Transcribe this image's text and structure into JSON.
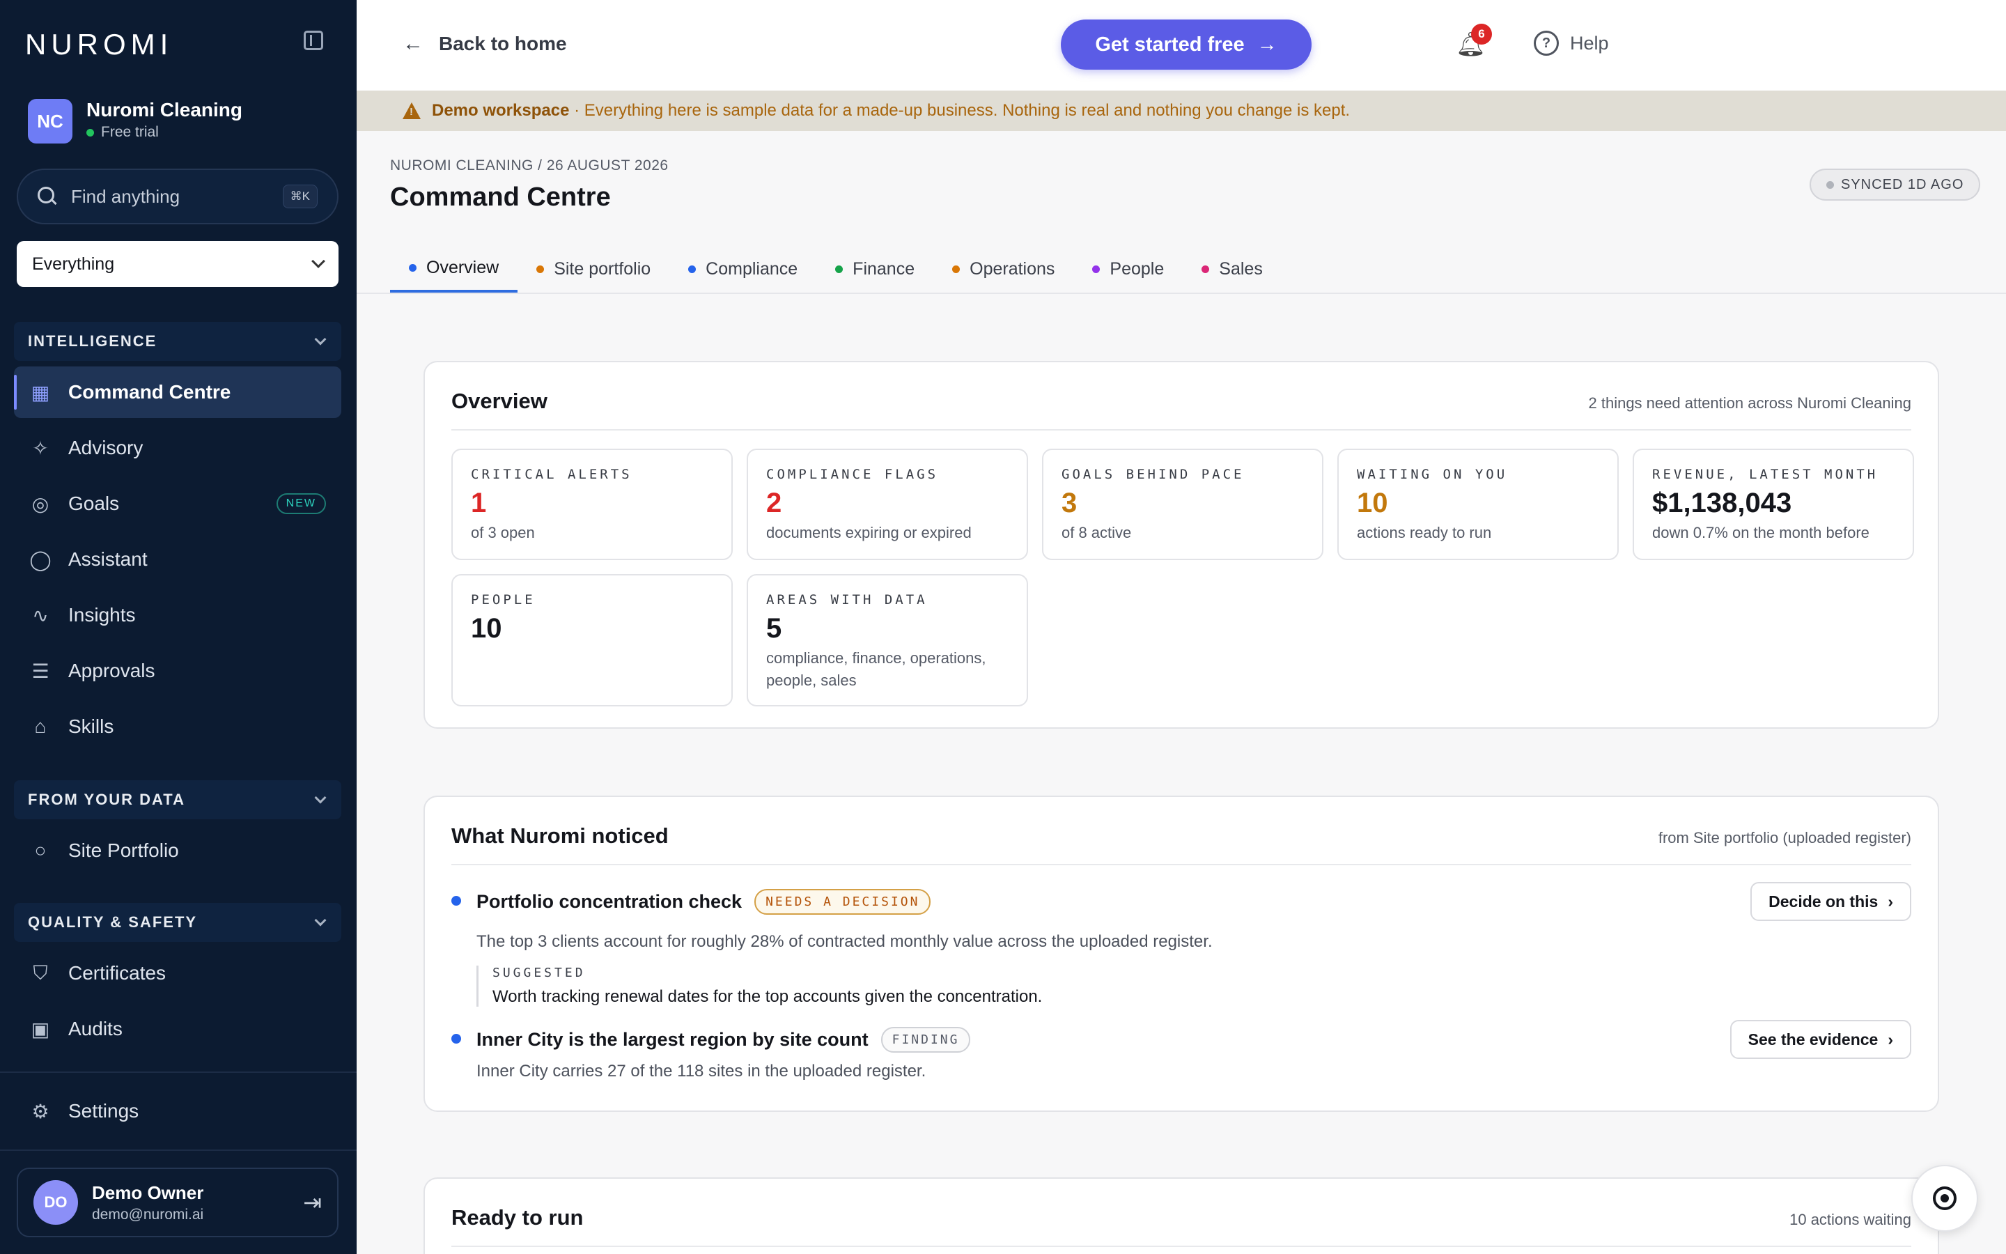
{
  "sidebar": {
    "logo": "NUROMI",
    "workspace": {
      "initials": "NC",
      "name": "Nuromi Cleaning",
      "plan": "Free trial"
    },
    "search": {
      "placeholder": "Find anything",
      "shortcut": "⌘K"
    },
    "scope": "Everything",
    "sections": [
      {
        "label": "INTELLIGENCE",
        "items": [
          {
            "label": "Command Centre",
            "icon": "grid-icon",
            "active": true
          },
          {
            "label": "Advisory",
            "icon": "sparkles-icon"
          },
          {
            "label": "Goals",
            "icon": "target-icon",
            "badge": "NEW"
          },
          {
            "label": "Assistant",
            "icon": "chat-bubble-icon"
          },
          {
            "label": "Insights",
            "icon": "pulse-icon"
          },
          {
            "label": "Approvals",
            "icon": "checklist-icon"
          },
          {
            "label": "Skills",
            "icon": "graduation-cap-icon"
          }
        ]
      },
      {
        "label": "FROM YOUR DATA",
        "items": [
          {
            "label": "Site Portfolio",
            "icon": "circle-icon"
          }
        ]
      },
      {
        "label": "QUALITY & SAFETY",
        "items": [
          {
            "label": "Certificates",
            "icon": "shield-check-icon"
          },
          {
            "label": "Audits",
            "icon": "clipboard-check-icon"
          }
        ]
      }
    ],
    "settings": "Settings",
    "user": {
      "initials": "DO",
      "name": "Demo Owner",
      "email": "demo@nuromi.ai"
    }
  },
  "topbar": {
    "back": "Back to home",
    "cta": "Get started free",
    "notifications": "6",
    "help": "Help"
  },
  "banner": {
    "label": "Demo workspace",
    "text": "· Everything here is sample data for a made-up business. Nothing is real and nothing you change is kept."
  },
  "header": {
    "breadcrumb": "NUROMI CLEANING / 26 AUGUST 2026",
    "title": "Command Centre",
    "synced": "SYNCED 1D AGO",
    "tabs": [
      {
        "label": "Overview",
        "color": "#2563eb"
      },
      {
        "label": "Site portfolio",
        "color": "#d97706"
      },
      {
        "label": "Compliance",
        "color": "#2563eb"
      },
      {
        "label": "Finance",
        "color": "#16a34a"
      },
      {
        "label": "Operations",
        "color": "#d97706"
      },
      {
        "label": "People",
        "color": "#9333ea"
      },
      {
        "label": "Sales",
        "color": "#db2777"
      }
    ]
  },
  "overview": {
    "title": "Overview",
    "meta": "2 things need attention across Nuromi Cleaning",
    "stats": [
      {
        "label": "CRITICAL ALERTS",
        "value": "1",
        "sub": "of 3 open",
        "color": "#dc2626"
      },
      {
        "label": "COMPLIANCE FLAGS",
        "value": "2",
        "sub": "documents expiring or expired",
        "color": "#dc2626"
      },
      {
        "label": "GOALS BEHIND PACE",
        "value": "3",
        "sub": "of 8 active",
        "color": "#c2780c"
      },
      {
        "label": "WAITING ON YOU",
        "value": "10",
        "sub": "actions ready to run",
        "color": "#c2780c"
      },
      {
        "label": "REVENUE, LATEST MONTH",
        "value": "$1,138,043",
        "sub": "down 0.7% on the month before",
        "color": "#14161c"
      },
      {
        "label": "PEOPLE",
        "value": "10",
        "sub": "",
        "color": "#14161c"
      },
      {
        "label": "AREAS WITH DATA",
        "value": "5",
        "sub": "compliance, finance, operations, people, sales",
        "color": "#14161c"
      }
    ]
  },
  "noticed": {
    "title": "What Nuromi noticed",
    "meta": "from Site portfolio (uploaded register)",
    "items": [
      {
        "title": "Portfolio concentration check",
        "tag": "NEEDS A DECISION",
        "desc": "The top 3 clients account for roughly 28% of contracted monthly value across the uploaded register.",
        "suggest_label": "SUGGESTED",
        "suggest_text": "Worth tracking renewal dates for the top accounts given the concentration.",
        "button": "Decide on this"
      },
      {
        "title": "Inner City is the largest region by site count",
        "tag": "FINDING",
        "desc": "Inner City carries 27 of the 118 sites in the uploaded register.",
        "button": "See the evidence"
      }
    ]
  },
  "ready": {
    "title": "Ready to run",
    "meta": "10 actions waiting"
  }
}
